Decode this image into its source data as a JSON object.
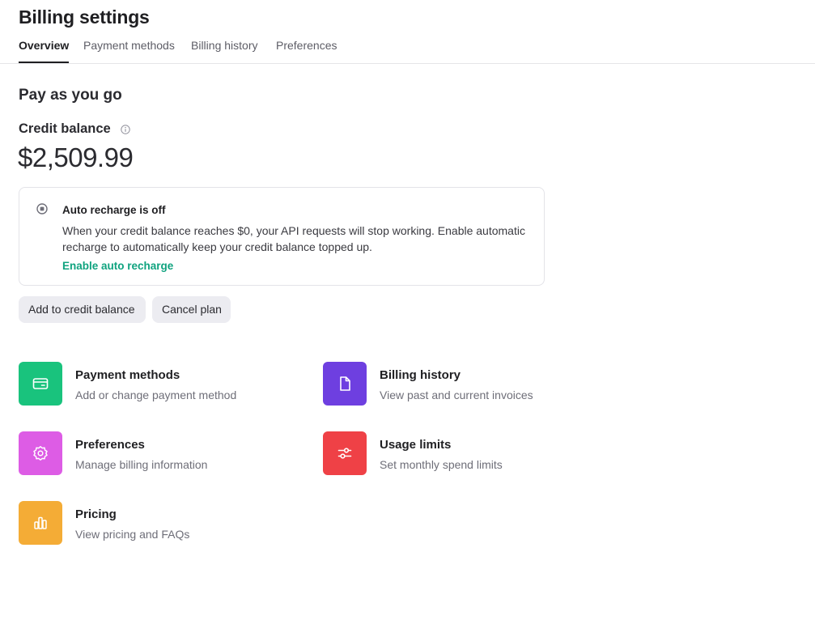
{
  "header": {
    "title": "Billing settings"
  },
  "tabs": [
    {
      "label": "Overview",
      "active": true
    },
    {
      "label": "Payment methods",
      "active": false
    },
    {
      "label": "Billing history",
      "active": false
    },
    {
      "label": "Preferences",
      "active": false
    }
  ],
  "main": {
    "section_title": "Pay as you go",
    "credit_label": "Credit balance",
    "credit_info_icon": "info-icon",
    "credit_amount": "$2,509.99",
    "notice": {
      "icon": "radio-off-icon",
      "title": "Auto recharge is off",
      "body": "When your credit balance reaches $0, your API requests will stop working. Enable automatic recharge to automatically keep your credit balance topped up.",
      "link": "Enable auto recharge"
    },
    "buttons": {
      "add": "Add to credit balance",
      "cancel": "Cancel plan"
    }
  },
  "cards": [
    {
      "title": "Payment methods",
      "desc": "Add or change payment method",
      "icon": "credit-card-icon",
      "color": "#19c37d"
    },
    {
      "title": "Billing history",
      "desc": "View past and current invoices",
      "icon": "document-icon",
      "color": "#6e3fe0"
    },
    {
      "title": "Preferences",
      "desc": "Manage billing information",
      "icon": "gear-icon",
      "color": "#dd5ce5"
    },
    {
      "title": "Usage limits",
      "desc": "Set monthly spend limits",
      "icon": "sliders-icon",
      "color": "#ef4146"
    },
    {
      "title": "Pricing",
      "desc": "View pricing and FAQs",
      "icon": "bar-chart-icon",
      "color": "#f4ac36"
    }
  ],
  "colors": {
    "accent_link": "#10a37f",
    "button_bg": "#ececf1",
    "border": "#e3e3e8"
  }
}
